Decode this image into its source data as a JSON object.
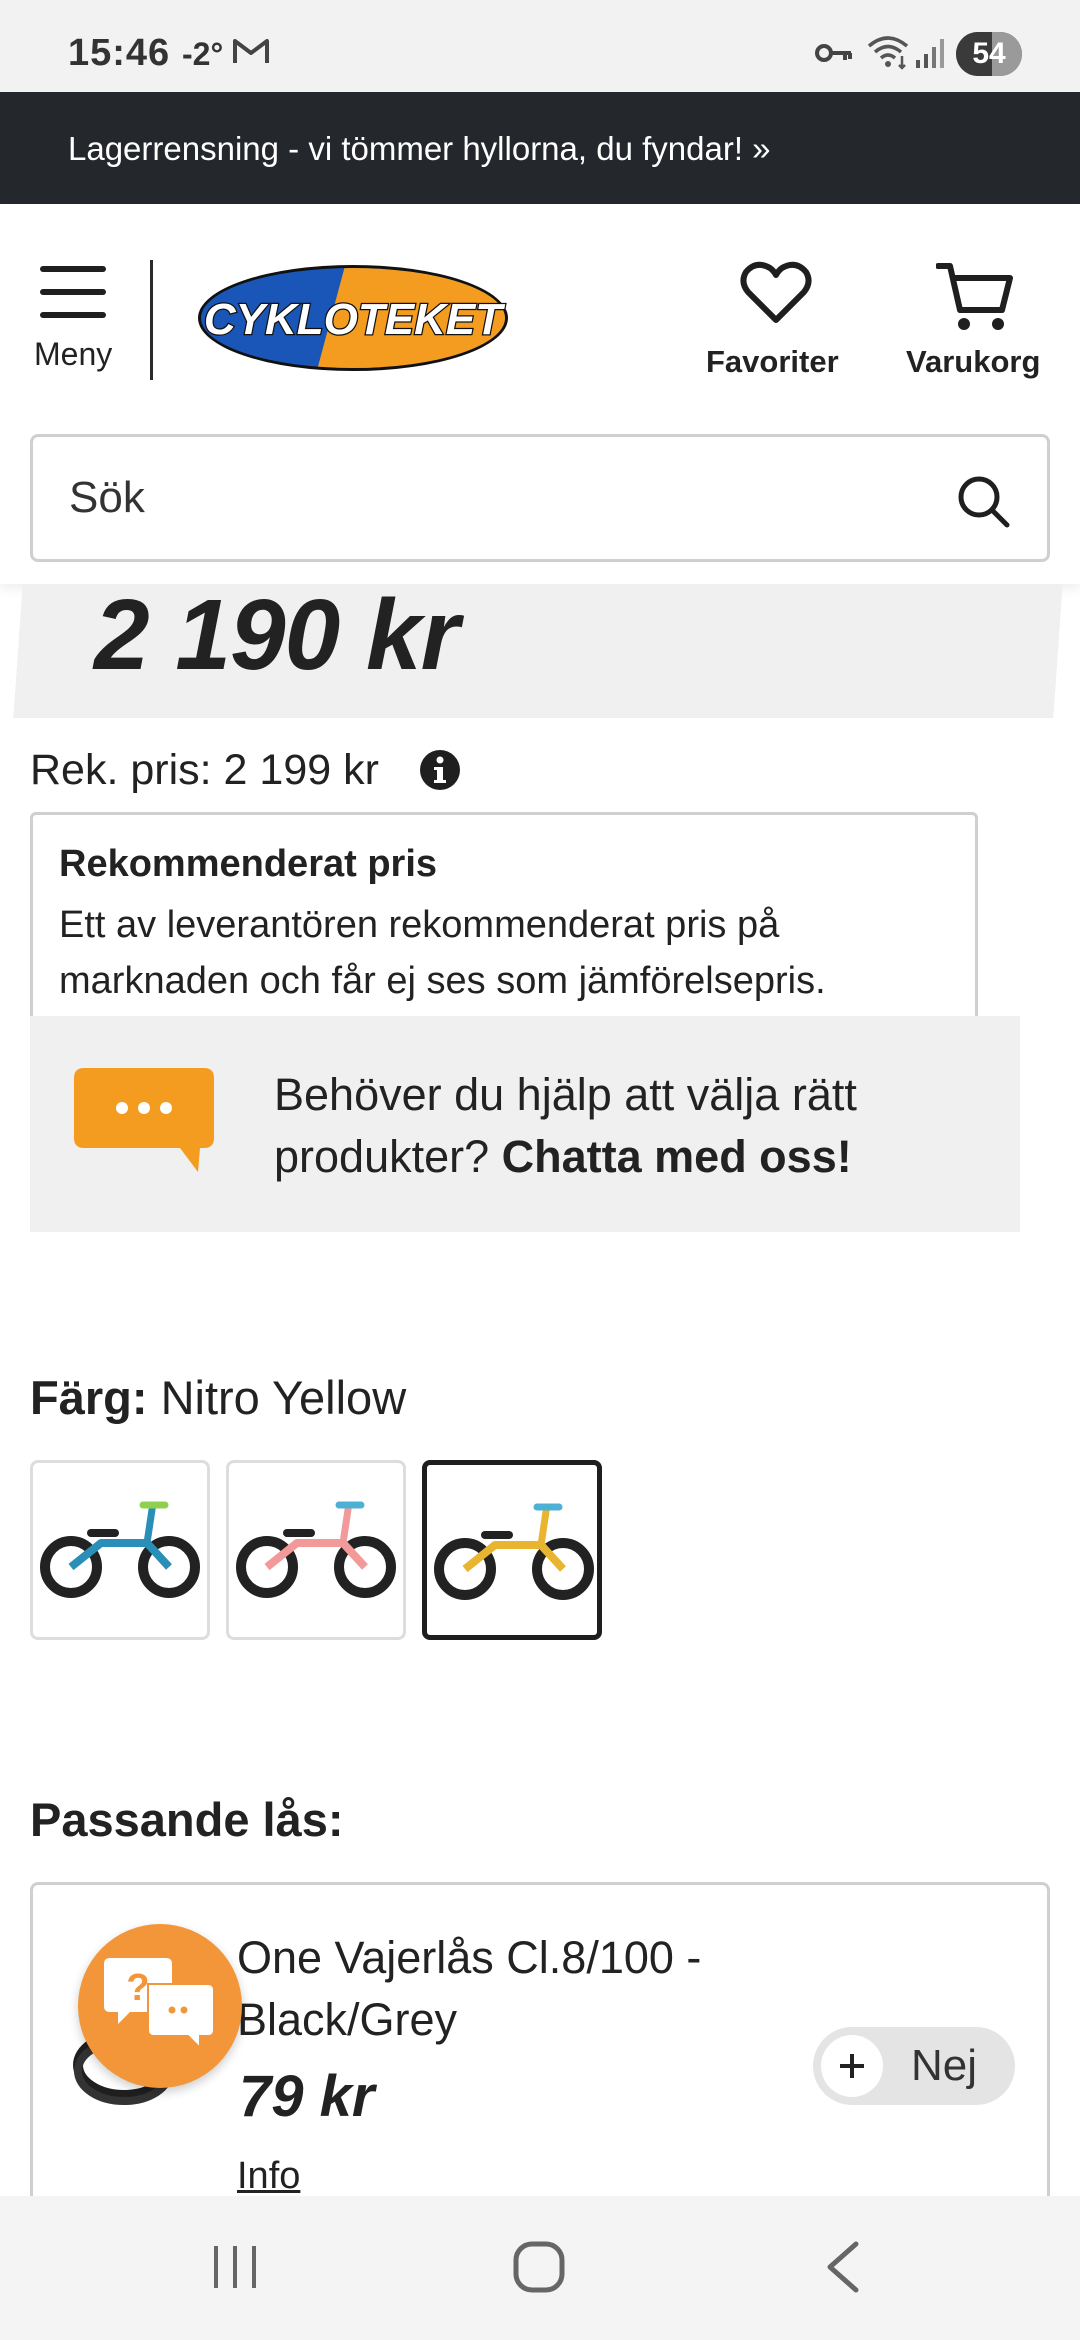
{
  "status_bar": {
    "time": "15:46",
    "temperature": "-2°",
    "battery": "54",
    "battery_level_percent": 54,
    "icons": [
      "gmail-icon",
      "vpn-key-icon",
      "wifi-icon",
      "signal-icon",
      "battery-icon"
    ]
  },
  "promo_banner": {
    "text": "Lagerrensning - vi tömmer hyllorna, du fyndar! »"
  },
  "header": {
    "menu_label": "Meny",
    "logo_text": "CYKLOTEKET",
    "favorites_label": "Favoriter",
    "cart_label": "Varukorg"
  },
  "search": {
    "placeholder": "Sök"
  },
  "product": {
    "price": "2 190 kr",
    "recommended_price": "Rek. pris: 2 199 kr",
    "tooltip": {
      "title": "Rekommenderat pris",
      "body": "Ett av leverantören rekommenderat pris på marknaden och får ej ses som jämförelsepris."
    },
    "chat_prompt": {
      "text": "Behöver du hjälp att välja rätt produkter? ",
      "link": "Chatta med oss!"
    },
    "color": {
      "label": "Färg:",
      "value": "Nitro Yellow",
      "swatches": [
        {
          "name": "blue",
          "color": "#2a8fb8",
          "selected": false
        },
        {
          "name": "pink",
          "color": "#f29a9a",
          "selected": false
        },
        {
          "name": "yellow",
          "color": "#e9b530",
          "selected": true
        }
      ]
    }
  },
  "matching_locks": {
    "title": "Passande lås:",
    "items": [
      {
        "name": "One Vajerlås Cl.8/100 - Black/Grey",
        "price": "79 kr",
        "info": "Info",
        "toggle_label": "Nej"
      }
    ]
  },
  "colors": {
    "banner_bg": "#24282c",
    "accent_orange": "#f39c1f",
    "logo_blue": "#1a56b8"
  }
}
